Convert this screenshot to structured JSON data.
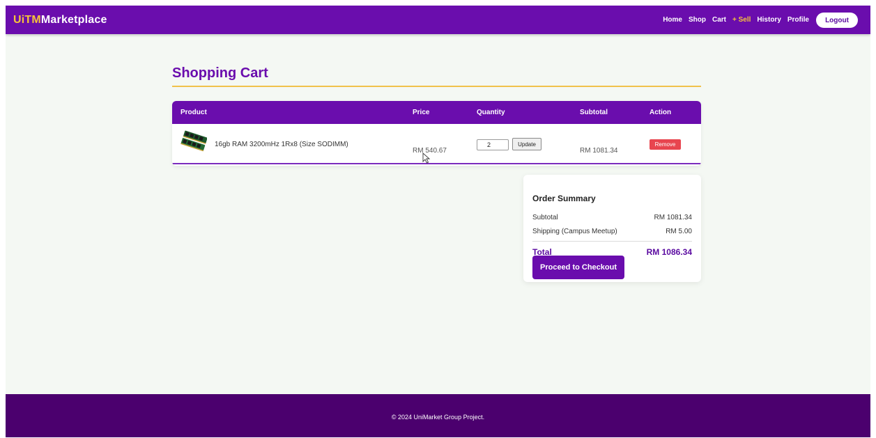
{
  "navbar": {
    "brand_part1": "UiTM",
    "brand_part2": "Marketplace",
    "links": {
      "home": "Home",
      "shop": "Shop",
      "cart": "Cart",
      "sell": "+ Sell",
      "history": "History",
      "profile": "Profile"
    },
    "logout_label": "Logout"
  },
  "page": {
    "title": "Shopping Cart"
  },
  "cart": {
    "columns": {
      "product": "Product",
      "price": "Price",
      "quantity": "Quantity",
      "subtotal": "Subtotal",
      "action": "Action"
    },
    "items": [
      {
        "name": "16gb RAM 3200mHz 1Rx8 (Size SODIMM)",
        "price": "RM 540.67",
        "quantity": "2",
        "subtotal": "RM 1081.34",
        "update_label": "Update",
        "remove_label": "Remove"
      }
    ]
  },
  "summary": {
    "title": "Order Summary",
    "subtotal_label": "Subtotal",
    "subtotal_value": "RM 1081.34",
    "shipping_label": "Shipping (Campus Meetup)",
    "shipping_value": "RM 5.00",
    "total_label": "Total",
    "total_value": "RM 1086.34",
    "checkout_label": "Proceed to Checkout"
  },
  "footer": {
    "text": "© 2024 UniMarket Group Project."
  },
  "colors": {
    "primary": "#6a0dad",
    "accent": "#f6c43a",
    "danger": "#e8454f",
    "footer": "#4b006e",
    "background": "#f4f8f3"
  },
  "icons": {
    "product_thumbnail": "ram-module-image",
    "cursor": "mouse-pointer-icon"
  }
}
